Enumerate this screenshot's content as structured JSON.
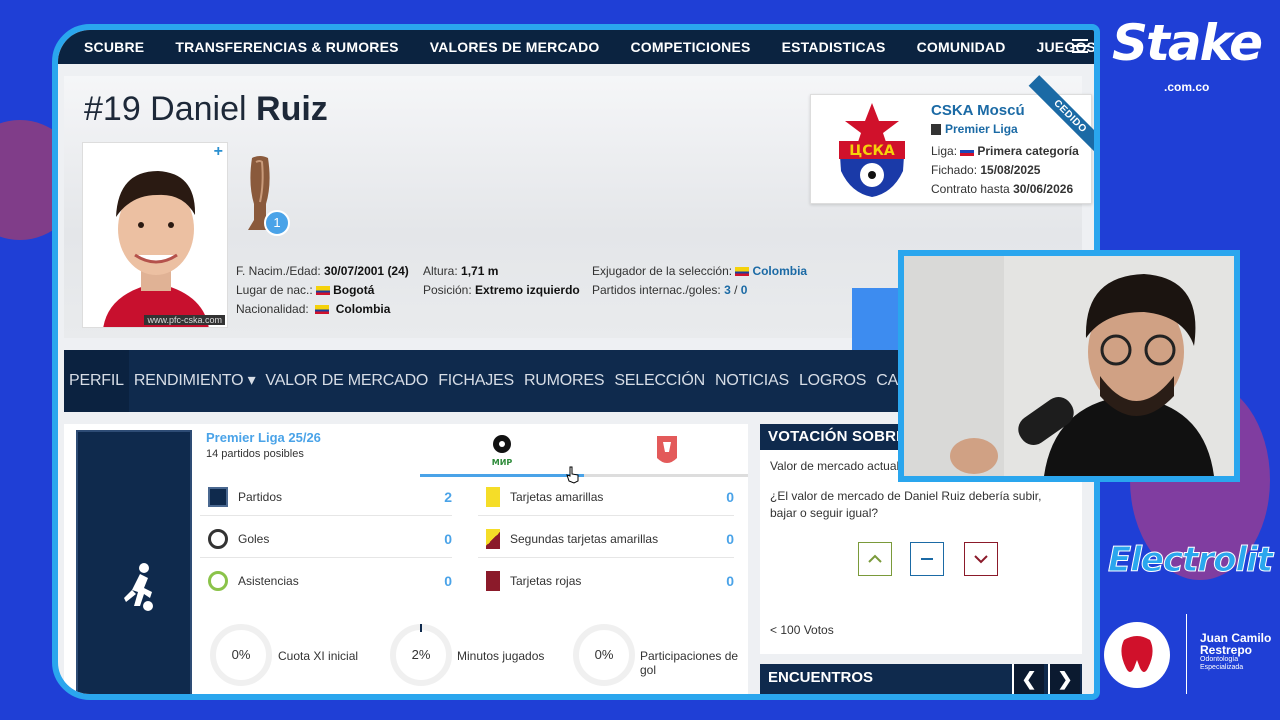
{
  "topnav": {
    "items": [
      "SCUBRE",
      "TRANSFERENCIAS & RUMORES",
      "VALORES DE MERCADO",
      "COMPETICIONES",
      "ESTADISTICAS",
      "COMUNIDAD",
      "JUEGOS"
    ]
  },
  "player": {
    "number_name": "#19 Daniel ",
    "surname": "Ruiz",
    "photo_credit": "www.pfc-cska.com",
    "trophy_count": "1",
    "birth_label": "F. Nacim./Edad:",
    "birth_value": "30/07/2001 (24)",
    "place_label": "Lugar de nac.:",
    "place_value": "Bogotá",
    "nationality_label": "Nacionalidad:",
    "nationality_value": "Colombia",
    "height_label": "Altura:",
    "height_value": "1,71 m",
    "position_label": "Posición:",
    "position_value": "Extremo izquierdo",
    "national_label": "Exjugador de la selección:",
    "national_value": "Colombia",
    "intl_label": "Partidos internac./goles:",
    "intl_matches": "3",
    "intl_sep": " / ",
    "intl_goals": "0"
  },
  "club": {
    "name": "CSKA Moscú",
    "league": "Premier Liga",
    "liga_label": "Liga:",
    "liga_value": "Primera categoría",
    "signed_label": "Fichado:",
    "signed_value": "15/08/2025",
    "contract_label": "Contrato hasta",
    "contract_value": "30/06/2026",
    "badge": "CEDIDO",
    "crest_text": "ЦСКА"
  },
  "subnav": {
    "items": [
      "PERFIL",
      "RENDIMIENTO ▾",
      "VALOR DE MERCADO",
      "FICHAJES",
      "RUMORES",
      "SELECCIÓN",
      "NOTICIAS",
      "LOGROS",
      "CARRERA ▾"
    ]
  },
  "stats": {
    "competition": "Premier Liga 25/26",
    "possible": "14 partidos posibles",
    "rpl_text": "МИР",
    "left": [
      {
        "label": "Partidos",
        "value": "2"
      },
      {
        "label": "Goles",
        "value": "0"
      },
      {
        "label": "Asistencias",
        "value": "0"
      }
    ],
    "right": [
      {
        "label": "Tarjetas amarillas",
        "value": "0"
      },
      {
        "label": "Segundas tarjetas amarillas",
        "value": "0"
      },
      {
        "label": "Tarjetas rojas",
        "value": "0"
      }
    ],
    "rings": [
      {
        "value": "0%",
        "label": "Cuota XI inicial",
        "fraction": 0
      },
      {
        "value": "2%",
        "label": "Minutos jugados",
        "fraction": 0.02
      },
      {
        "value": "0%",
        "label": "Participaciones de gol",
        "fraction": 0
      }
    ]
  },
  "vote": {
    "title": "VOTACIÓN SOBRE EL V",
    "market": "Valor de mercado actual",
    "question": "¿El valor de mercado de Daniel Ruiz debería subir, bajar o seguir igual?",
    "count": "< 100 Votos"
  },
  "encuentros": {
    "title": "ENCUENTROS",
    "prev": "❮",
    "next": "❯"
  },
  "overlay": {
    "stake": "Stake",
    "stake_sub": ".com.co",
    "electrolit": "Electrolit",
    "sponsor_name": "Juan Camilo Restrepo",
    "sponsor_sub": "Odontología Especializada"
  },
  "colors": {
    "accent": "#4aa3e8",
    "nav": "#0f2a4d",
    "frame": "#2aa6ee",
    "bg": "#1f3fd6"
  }
}
